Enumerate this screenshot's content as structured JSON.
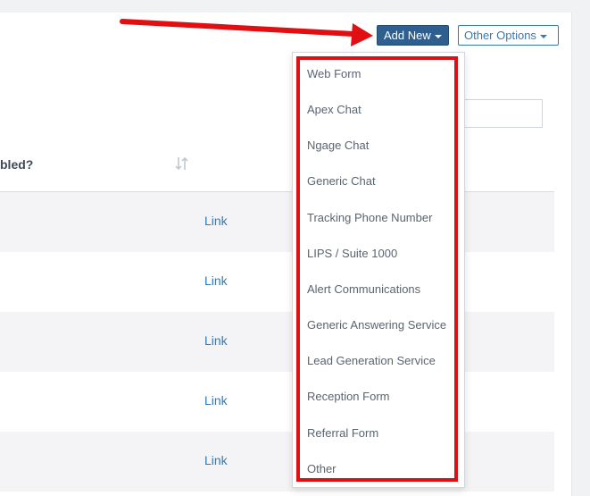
{
  "toolbar": {
    "add_new_label": "Add New",
    "other_options_label": "Other Options"
  },
  "table": {
    "partial_header": "bled?",
    "rows": [
      {
        "link": "Link"
      },
      {
        "link": "Link"
      },
      {
        "link": "Link"
      },
      {
        "link": "Link"
      },
      {
        "link": "Link"
      }
    ]
  },
  "dropdown": {
    "items": [
      "Web Form",
      "Apex Chat",
      "Ngage Chat",
      "Generic Chat",
      "Tracking Phone Number",
      "LIPS / Suite 1000",
      "Alert Communications",
      "Generic Answering Service",
      "Lead Generation Service",
      "Reception Form",
      "Referral Form",
      "Other"
    ]
  },
  "annotation": {
    "color": "#e10f12"
  },
  "icons": {
    "sort": "sort-icon",
    "caret": "caret-down-icon"
  }
}
